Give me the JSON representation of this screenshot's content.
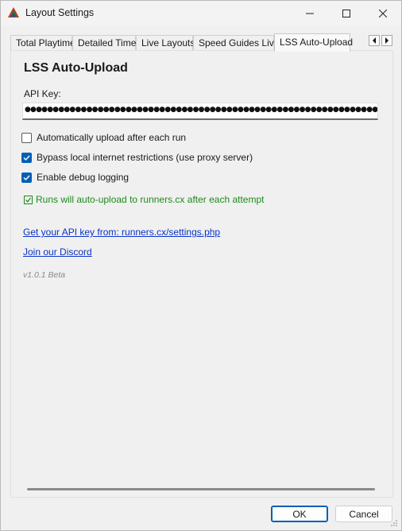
{
  "window": {
    "title": "Layout Settings"
  },
  "tabs": [
    {
      "label": "Total Playtime",
      "active": false
    },
    {
      "label": "Detailed Timer",
      "active": false
    },
    {
      "label": "Live Layouts",
      "active": false
    },
    {
      "label": "Speed Guides Live",
      "active": false
    },
    {
      "label": "LSS Auto-Upload",
      "active": true
    }
  ],
  "panel": {
    "title": "LSS Auto-Upload",
    "api_key_label": "API Key:",
    "api_key_masked": "●●●●●●●●●●●●●●●●●●●●●●●●●●●●●●●●●●●●●●●●●●●●●●●●●●●●●●●●●●●●●●●●●●●●●●●●●●●●●●●●●●●●",
    "checkboxes": [
      {
        "label": "Automatically upload after each run",
        "checked": false
      },
      {
        "label": "Bypass local internet restrictions (use proxy server)",
        "checked": true
      },
      {
        "label": "Enable debug logging",
        "checked": true
      }
    ],
    "status_text": "Runs will auto-upload to runners.cx after each attempt",
    "api_link": "Get your API key from: runners.cx/settings.php",
    "discord_link": "Join our Discord",
    "version": "v1.0.1 Beta"
  },
  "buttons": {
    "ok": "OK",
    "cancel": "Cancel"
  },
  "colors": {
    "accent": "#005fb8",
    "status_green": "#1d8a1d",
    "link": "#0b33c7"
  }
}
